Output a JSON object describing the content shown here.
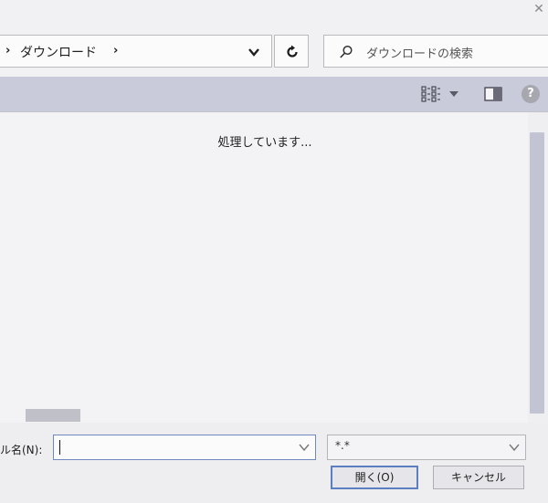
{
  "address_bar": {
    "path_separator": "›",
    "current_folder": "ダウンロード",
    "trailing_separator": "›"
  },
  "search": {
    "placeholder": "ダウンロードの検索"
  },
  "toolbar": {
    "icons": [
      "view-toggle-icon",
      "chevron-down-icon",
      "preview-pane-icon",
      "help-icon"
    ],
    "help_label": "?"
  },
  "content": {
    "status_text": "処理しています..."
  },
  "footer": {
    "filename_label": "ル名(N):",
    "filename_value": "",
    "file_type_value": "*.*",
    "open_label": "開く(O)",
    "cancel_label": "キャンセル"
  },
  "colors": {
    "toolbar_bg": "#c9cbdb",
    "focus_border": "#5c7fc2",
    "scroll_thumb": "#c2c4d4"
  }
}
